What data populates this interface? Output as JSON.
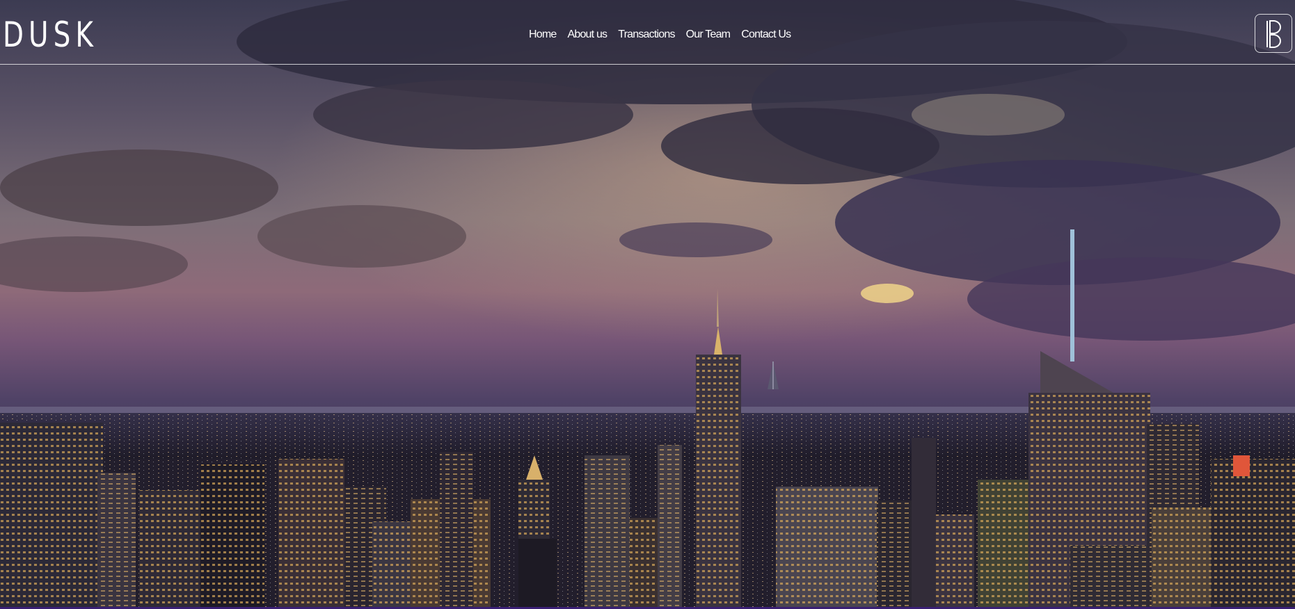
{
  "brand": {
    "logo_text": "DUSK"
  },
  "nav": {
    "items": [
      {
        "label": "Home"
      },
      {
        "label": "About us"
      },
      {
        "label": "Transactions"
      },
      {
        "label": "Our Team"
      },
      {
        "label": "Contact Us"
      }
    ]
  },
  "header_right": {
    "icon": "brand-monogram-icon"
  },
  "hero": {
    "image": "city-skyline-at-dusk"
  },
  "colors": {
    "nav_text": "#ffffff",
    "bottom_bar": "#3a1f74"
  }
}
